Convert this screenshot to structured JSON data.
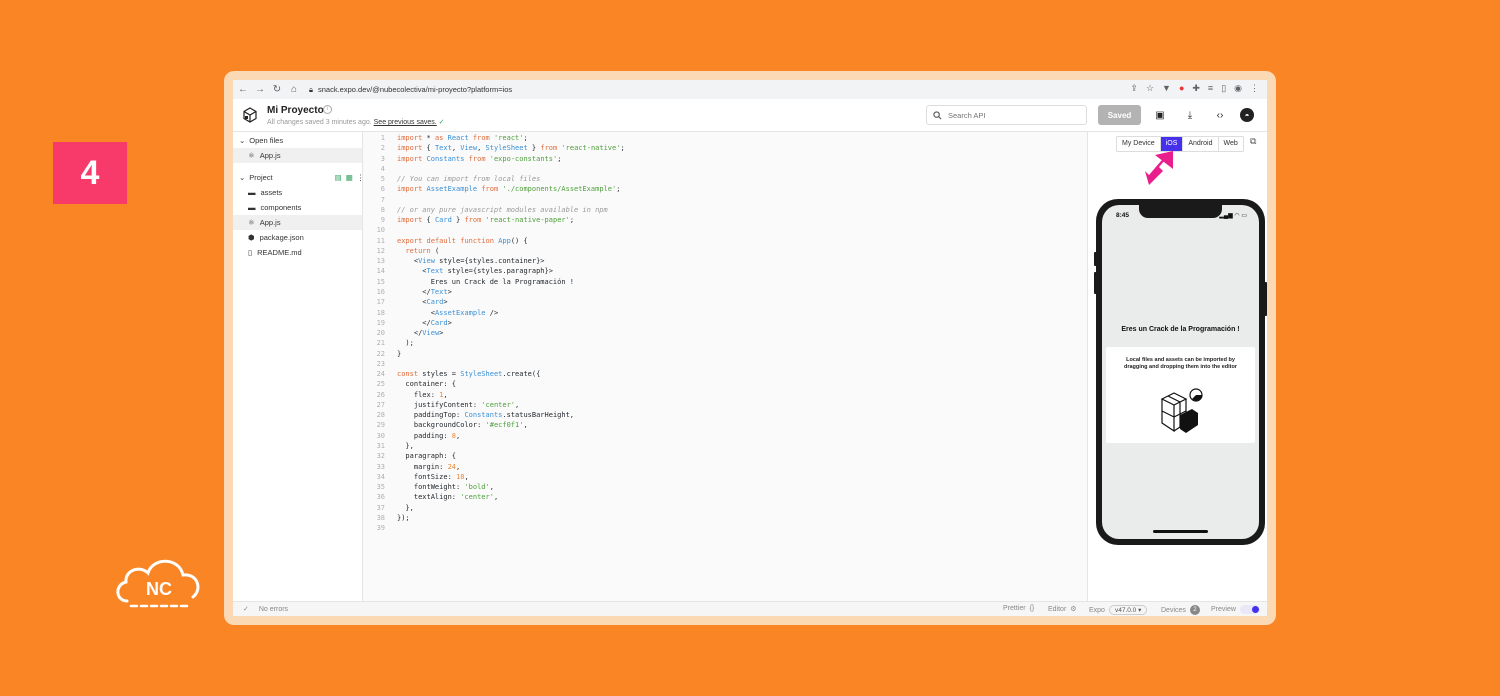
{
  "step_badge": "4",
  "nc_logo_text": "NC",
  "browser": {
    "url": "snack.expo.dev/@nubecolectiva/mi-proyecto?platform=ios"
  },
  "header": {
    "project_title": "Mi Proyecto",
    "info_icon": "i",
    "save_status": "All changes saved 3 minutes ago.",
    "see_previous": "See previous saves.",
    "search_placeholder": "Search API",
    "saved_button": "Saved"
  },
  "sidebar": {
    "open_files_label": "Open files",
    "open_files": [
      "App.js"
    ],
    "project_label": "Project",
    "project_items": [
      {
        "name": "assets",
        "icon": "folder-icon"
      },
      {
        "name": "components",
        "icon": "folder-icon"
      },
      {
        "name": "App.js",
        "icon": "js-file-icon"
      },
      {
        "name": "package.json",
        "icon": "package-icon"
      },
      {
        "name": "README.md",
        "icon": "doc-icon"
      }
    ]
  },
  "editor": {
    "lines": [
      "import * as React from 'react';",
      "import { Text, View, StyleSheet } from 'react-native';",
      "import Constants from 'expo-constants';",
      "",
      "// You can import from local files",
      "import AssetExample from './components/AssetExample';",
      "",
      "// or any pure javascript modules available in npm",
      "import { Card } from 'react-native-paper';",
      "",
      "export default function App() {",
      "  return (",
      "    <View style={styles.container}>",
      "      <Text style={styles.paragraph}>",
      "        Eres un Crack de la Programación !",
      "      </Text>",
      "      <Card>",
      "        <AssetExample />",
      "      </Card>",
      "    </View>",
      "  );",
      "}",
      "",
      "const styles = StyleSheet.create({",
      "  container: {",
      "    flex: 1,",
      "    justifyContent: 'center',",
      "    paddingTop: Constants.statusBarHeight,",
      "    backgroundColor: '#ecf0f1',",
      "    padding: 8,",
      "  },",
      "  paragraph: {",
      "    margin: 24,",
      "    fontSize: 18,",
      "    fontWeight: 'bold',",
      "    textAlign: 'center',",
      "  },",
      "});",
      ""
    ]
  },
  "preview": {
    "tabs": [
      "My Device",
      "iOS",
      "Android",
      "Web"
    ],
    "active_tab": "iOS",
    "phone_time": "8:45",
    "phone_heading": "Eres un Crack de la Programación !",
    "card_text": "Local files and assets can be imported by dragging and dropping them into the editor"
  },
  "footer": {
    "errors": "No errors",
    "prettier": "Prettier",
    "editor": "Editor",
    "expo": "Expo",
    "expo_version": "v47.0.0",
    "devices": "Devices",
    "devices_count": "2",
    "preview": "Preview"
  },
  "colors": {
    "background": "#f98524",
    "badge": "#f73a6a",
    "accent": "#4630eb",
    "arrow": "#e91e8c"
  }
}
